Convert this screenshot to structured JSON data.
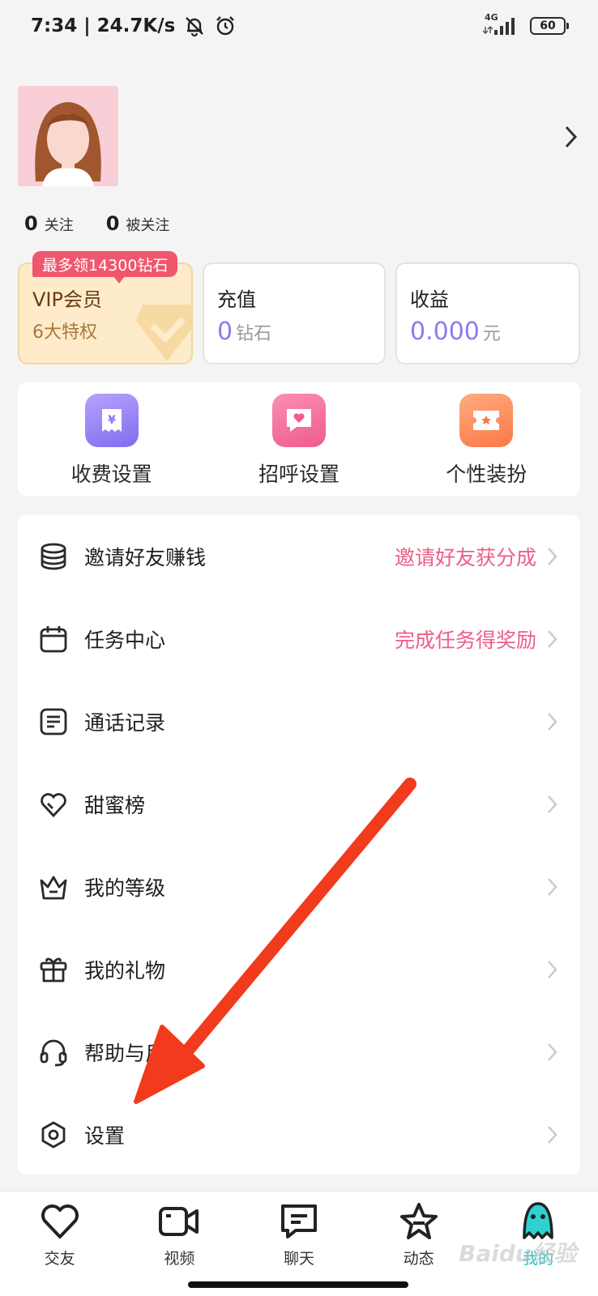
{
  "status_bar": {
    "time_speed": "7:34 | 24.7K/s",
    "network": "4G",
    "battery": "60"
  },
  "profile": {
    "following_count": "0",
    "following_label": "关注",
    "followers_count": "0",
    "followers_label": "被关注"
  },
  "cards": {
    "vip_badge": "最多领14300钻石",
    "vip_title": "VIP会员",
    "vip_sub": "6大特权",
    "recharge_title": "充值",
    "recharge_value": "0",
    "recharge_unit": "钻石",
    "income_title": "收益",
    "income_value": "0.000",
    "income_unit": "元"
  },
  "quick_settings": [
    {
      "label": "收费设置"
    },
    {
      "label": "招呼设置"
    },
    {
      "label": "个性装扮"
    }
  ],
  "menu": [
    {
      "label": "邀请好友赚钱",
      "extra": "邀请好友获分成"
    },
    {
      "label": "任务中心",
      "extra": "完成任务得奖励"
    },
    {
      "label": "通话记录",
      "extra": ""
    },
    {
      "label": "甜蜜榜",
      "extra": ""
    },
    {
      "label": "我的等级",
      "extra": ""
    },
    {
      "label": "我的礼物",
      "extra": ""
    },
    {
      "label": "帮助与反馈",
      "extra": ""
    },
    {
      "label": "设置",
      "extra": ""
    }
  ],
  "bottom_nav": [
    {
      "label": "交友"
    },
    {
      "label": "视频"
    },
    {
      "label": "聊天"
    },
    {
      "label": "动态"
    },
    {
      "label": "我的"
    }
  ],
  "watermark": "Baidu经验",
  "colors": {
    "accent_pink": "#ec5f86",
    "accent_purple": "#8b7cf0",
    "nav_active": "#19c3c3",
    "arrow": "#f23a1c"
  }
}
